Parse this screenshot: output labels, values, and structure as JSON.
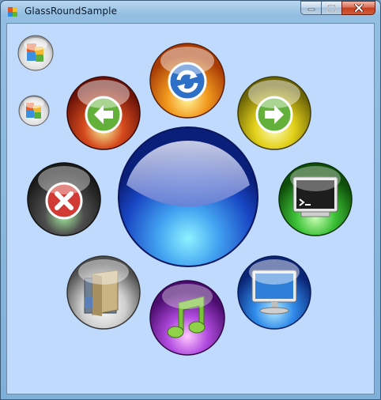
{
  "window": {
    "title": "GlassRoundSample"
  },
  "client": {
    "background": "#bfdafd"
  },
  "buttons": [
    {
      "name": "office-small-button-1",
      "icon": "office-logo-icon"
    },
    {
      "name": "office-small-button-2",
      "icon": "office-logo-icon"
    },
    {
      "name": "back-button",
      "icon": "arrow-left-icon",
      "color": "red"
    },
    {
      "name": "refresh-button",
      "icon": "refresh-icon",
      "color": "orange"
    },
    {
      "name": "forward-button",
      "icon": "arrow-right-icon",
      "color": "yellow"
    },
    {
      "name": "stop-button",
      "icon": "close-icon",
      "color": "dark-red"
    },
    {
      "name": "center-orb-button",
      "icon": "",
      "color": "blue"
    },
    {
      "name": "terminal-button",
      "icon": "terminal-icon",
      "color": "green"
    },
    {
      "name": "folder-button",
      "icon": "folder-icon",
      "color": "gray"
    },
    {
      "name": "music-button",
      "icon": "music-note-icon",
      "color": "purple"
    },
    {
      "name": "computer-button",
      "icon": "monitor-icon",
      "color": "blue"
    }
  ]
}
